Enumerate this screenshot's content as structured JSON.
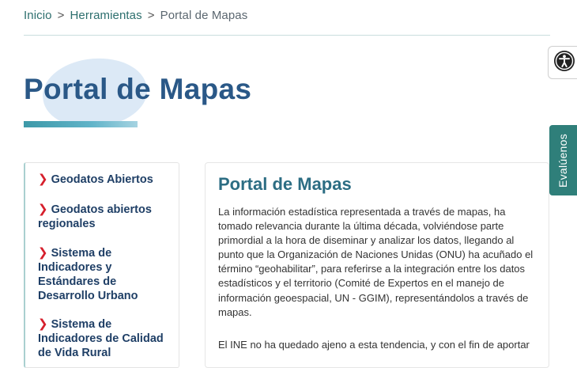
{
  "breadcrumb": {
    "items": [
      "Inicio",
      "Herramientas"
    ],
    "separator": ">",
    "current": "Portal de Mapas"
  },
  "page": {
    "title": "Portal de Mapas"
  },
  "accessibility": {
    "icon": "accessibility-icon"
  },
  "feedback": {
    "label": "Evalúenos"
  },
  "sidebar": {
    "items": [
      {
        "label": "Geodatos Abiertos",
        "icon": "chevron-right-icon"
      },
      {
        "label": "Geodatos abiertos regionales",
        "icon": "chevron-right-icon"
      },
      {
        "label": "Sistema de Indicadores y Estándares de Desarrollo Urbano",
        "icon": "chevron-right-icon"
      },
      {
        "label": "Sistema de Indicadores de Calidad de Vida Rural",
        "icon": "chevron-right-icon"
      }
    ]
  },
  "content": {
    "title": "Portal de Mapas",
    "paragraphs": [
      "La información estadística representada a través de mapas, ha tomado relevancia durante la última década, volviéndose parte primordial a la hora de diseminar y analizar los datos, llegando al punto que la Organización de Naciones Unidas (ONU) ha acuñado el término “geohabilitar”, para referirse a la integración entre los datos estadísticos y el territorio (Comité de Expertos en el manejo de información geoespacial, UN - GGIM), representándolos a través de mapas.",
      "El INE no ha quedado ajeno a esta tendencia, y con el fin de aportar"
    ]
  },
  "colors": {
    "title_blue": "#2a5887",
    "teal": "#2f7f7a",
    "chevron_red": "#d61f2c",
    "nav_text": "#1f3f66"
  }
}
